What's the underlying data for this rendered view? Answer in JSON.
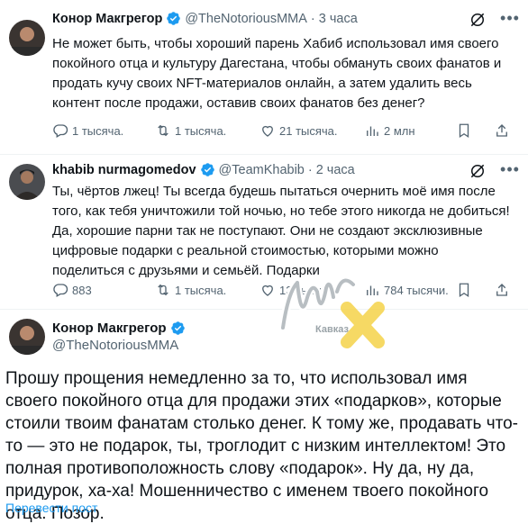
{
  "colors": {
    "accent": "#1d9bf0",
    "secondary_text": "#536471",
    "verified": "#1d9bf0",
    "watermark_x": "#f5d34a"
  },
  "tweet1": {
    "name": "Конор Макгрегор",
    "handle": "@TheNotoriousMMA",
    "dot": "·",
    "time": "3 часа",
    "text": "Не может быть, чтобы хороший парень Хабиб использовал имя своего покойного отца и культуру Дагестана, чтобы обмануть своих фанатов и продать кучу своих NFT-материалов онлайн, а затем удалить весь контент после продажи, оставив своих фанатов без денег?",
    "replies": "1 тысяча.",
    "retweets": "1 тысяча.",
    "likes": "21 тысяча.",
    "views": "2 млн"
  },
  "tweet2": {
    "name": "khabib nurmagomedov",
    "handle": "@TeamKhabib",
    "dot": "·",
    "time": "2 часа",
    "text": "Ты, чёртов лжец! Ты всегда будешь пытаться очернить моё имя после того, как тебя уничтожили той ночью, но тебе этого никогда не добиться! Да, хорошие парни так не поступают. Они не создают эксклюзивные цифровые подарки с реальной стоимостью, которыми можно поделиться с друзьями и семьёй. Подарки",
    "replies": "883",
    "retweets": "1 тысяча.",
    "likes": "13 тысяч.",
    "views": "784 тысячи."
  },
  "tweet3": {
    "name": "Конор Макгрегор",
    "handle": "@TheNotoriousMMA",
    "text": "Прошу прощения немедленно за то, что использовал имя своего покойного отца для продажи этих «подарков», которые стоили твоим фанатам столько денег. К тому же, продавать что-то — это не подарок, ты, троглодит с низким интеллектом! Это полная противоположность слову «подарок». Ну да, ну да, придурок, ха-ха! Мошенничество с именем твоего покойного отца. Позор.",
    "translate": "Перевести пост"
  },
  "watermark": {
    "brand": "Кавказ"
  },
  "icons": [
    "verified-badge-icon",
    "grok-icon",
    "more-icon",
    "reply-icon",
    "retweet-icon",
    "like-icon",
    "views-icon",
    "bookmark-icon",
    "share-icon"
  ]
}
